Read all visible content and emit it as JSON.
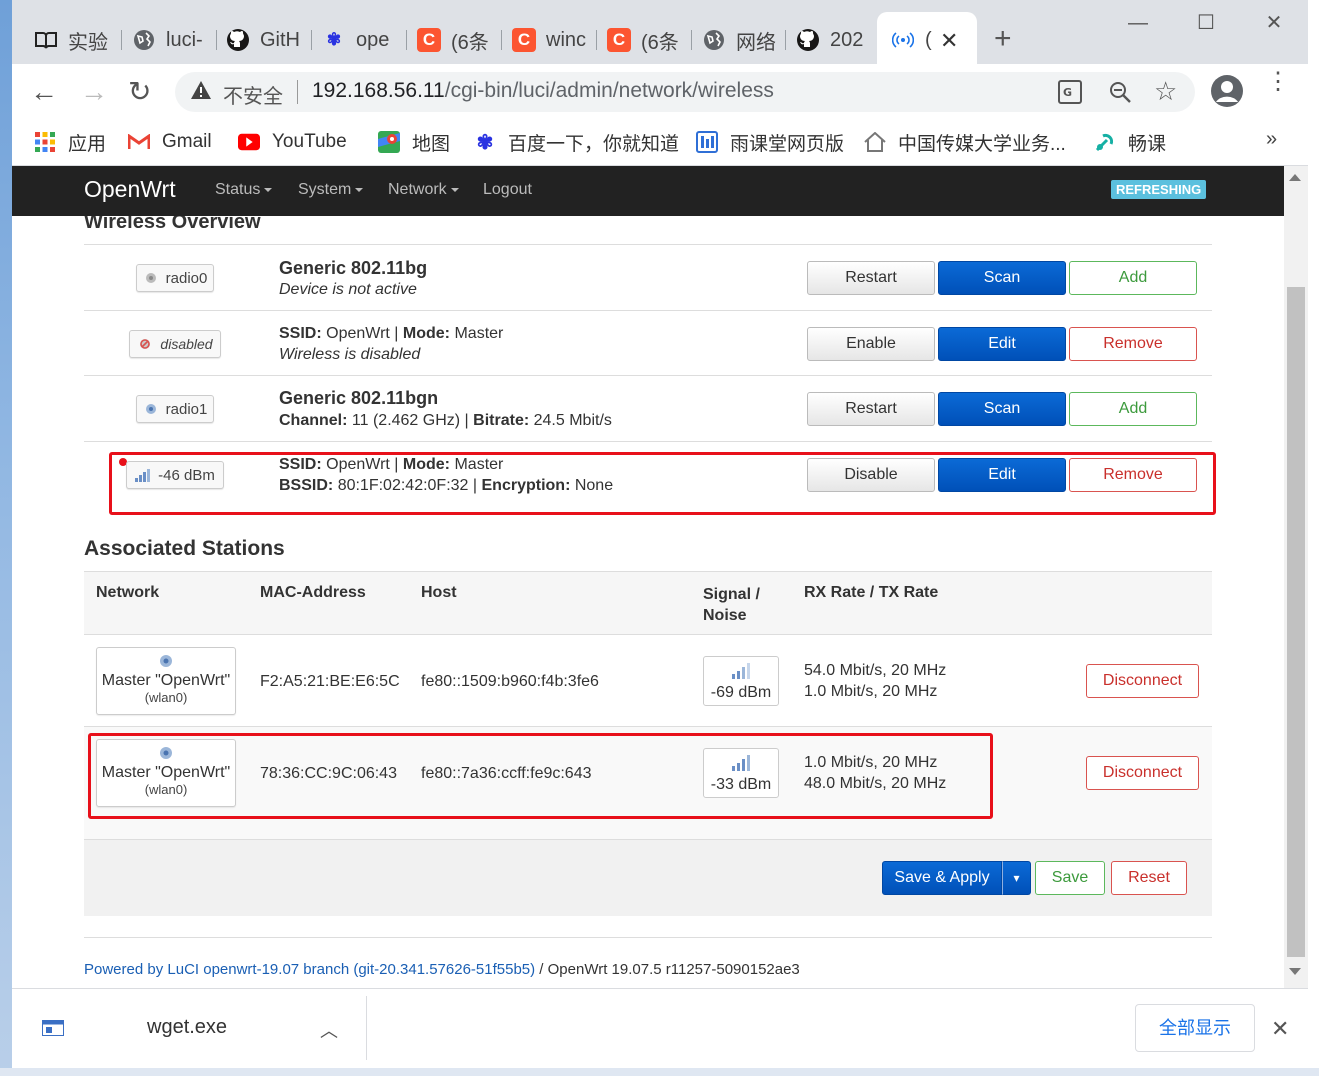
{
  "browser": {
    "tabs": [
      {
        "label": "实验",
        "icon": "book-icon"
      },
      {
        "label": "luci-",
        "icon": "globe-icon"
      },
      {
        "label": "GitH",
        "icon": "github-icon"
      },
      {
        "label": "ope",
        "icon": "baidu-paw-icon"
      },
      {
        "label": "(6条",
        "icon": "csdn-icon"
      },
      {
        "label": "winc",
        "icon": "csdn-icon"
      },
      {
        "label": "(6条",
        "icon": "csdn-icon"
      },
      {
        "label": "网络",
        "icon": "globe-icon"
      },
      {
        "label": "202",
        "icon": "github-icon"
      },
      {
        "label": "(",
        "icon": "wireless-icon"
      }
    ],
    "address": {
      "security_label": "不安全",
      "host": "192.168.56.11",
      "path": "/cgi-bin/luci/admin/network/wireless"
    },
    "bookmarks": [
      {
        "label": "应用",
        "icon": "apps-grid-icon"
      },
      {
        "label": "Gmail",
        "icon": "gmail-icon"
      },
      {
        "label": "YouTube",
        "icon": "youtube-icon"
      },
      {
        "label": "地图",
        "icon": "maps-icon"
      },
      {
        "label": "百度一下，你就知道",
        "icon": "baidu-paw-icon"
      },
      {
        "label": "雨课堂网页版",
        "icon": "rain-classroom-icon"
      },
      {
        "label": "中国传媒大学业务...",
        "icon": "home-icon"
      },
      {
        "label": "畅课",
        "icon": "tronclass-icon"
      }
    ],
    "more_bookmarks": "»"
  },
  "openwrt": {
    "brand": "OpenWrt",
    "menu": [
      "Status",
      "System",
      "Network",
      "Logout"
    ],
    "refreshing": "REFRESHING",
    "section_title": "Wireless Overview",
    "devices": [
      {
        "badge": "radio0",
        "title": "Generic 802.11bg",
        "subtitle": "Device is not active",
        "buttons": [
          "Restart",
          "Scan",
          "Add"
        ]
      },
      {
        "badge": "disabled",
        "ssid_label": "SSID:",
        "ssid": "OpenWrt",
        "mode_label": "Mode:",
        "mode": "Master",
        "status": "Wireless is disabled",
        "buttons": [
          "Enable",
          "Edit",
          "Remove"
        ]
      },
      {
        "badge": "radio1",
        "title": "Generic 802.11bgn",
        "channel_label": "Channel:",
        "channel": "11 (2.462 GHz)",
        "bitrate_label": "Bitrate:",
        "bitrate": "24.5 Mbit/s",
        "buttons": [
          "Restart",
          "Scan",
          "Add"
        ]
      },
      {
        "badge": "-46 dBm",
        "ssid_label": "SSID:",
        "ssid": "OpenWrt",
        "mode_label": "Mode:",
        "mode": "Master",
        "bssid_label": "BSSID:",
        "bssid": "80:1F:02:42:0F:32",
        "enc_label": "Encryption:",
        "enc": "None",
        "buttons": [
          "Disable",
          "Edit",
          "Remove"
        ]
      }
    ],
    "stations_title": "Associated Stations",
    "stations_headers": [
      "Network",
      "MAC-Address",
      "Host",
      "Signal /",
      "Noise",
      "RX Rate / TX Rate"
    ],
    "stations": [
      {
        "network": "Master \"OpenWrt\"",
        "iface": "(wlan0)",
        "mac": "F2:A5:21:BE:E6:5C",
        "host": "fe80::1509:b960:f4b:3fe6",
        "signal": "-69 dBm",
        "rx": "54.0 Mbit/s, 20 MHz",
        "tx": "1.0 Mbit/s, 20 MHz",
        "action": "Disconnect"
      },
      {
        "network": "Master \"OpenWrt\"",
        "iface": "(wlan0)",
        "mac": "78:36:CC:9C:06:43",
        "host": "fe80::7a36:ccff:fe9c:643",
        "signal": "-33 dBm",
        "rx": "1.0 Mbit/s, 20 MHz",
        "tx": "48.0 Mbit/s, 20 MHz",
        "action": "Disconnect"
      }
    ],
    "footer_buttons": {
      "save_apply": "Save & Apply",
      "dropdown": "▾",
      "save": "Save",
      "reset": "Reset"
    },
    "powered_by": "Powered by LuCI openwrt-19.07 branch (git-20.341.57626-51f55b5)",
    "powered_rest": " / OpenWrt 19.07.5 r11257-5090152ae3"
  },
  "downloads": {
    "file": "wget.exe",
    "show_all": "全部显示"
  },
  "colors": {
    "highlight": "#e8101a",
    "primary": "#0050b8",
    "navbar": "#222222"
  }
}
